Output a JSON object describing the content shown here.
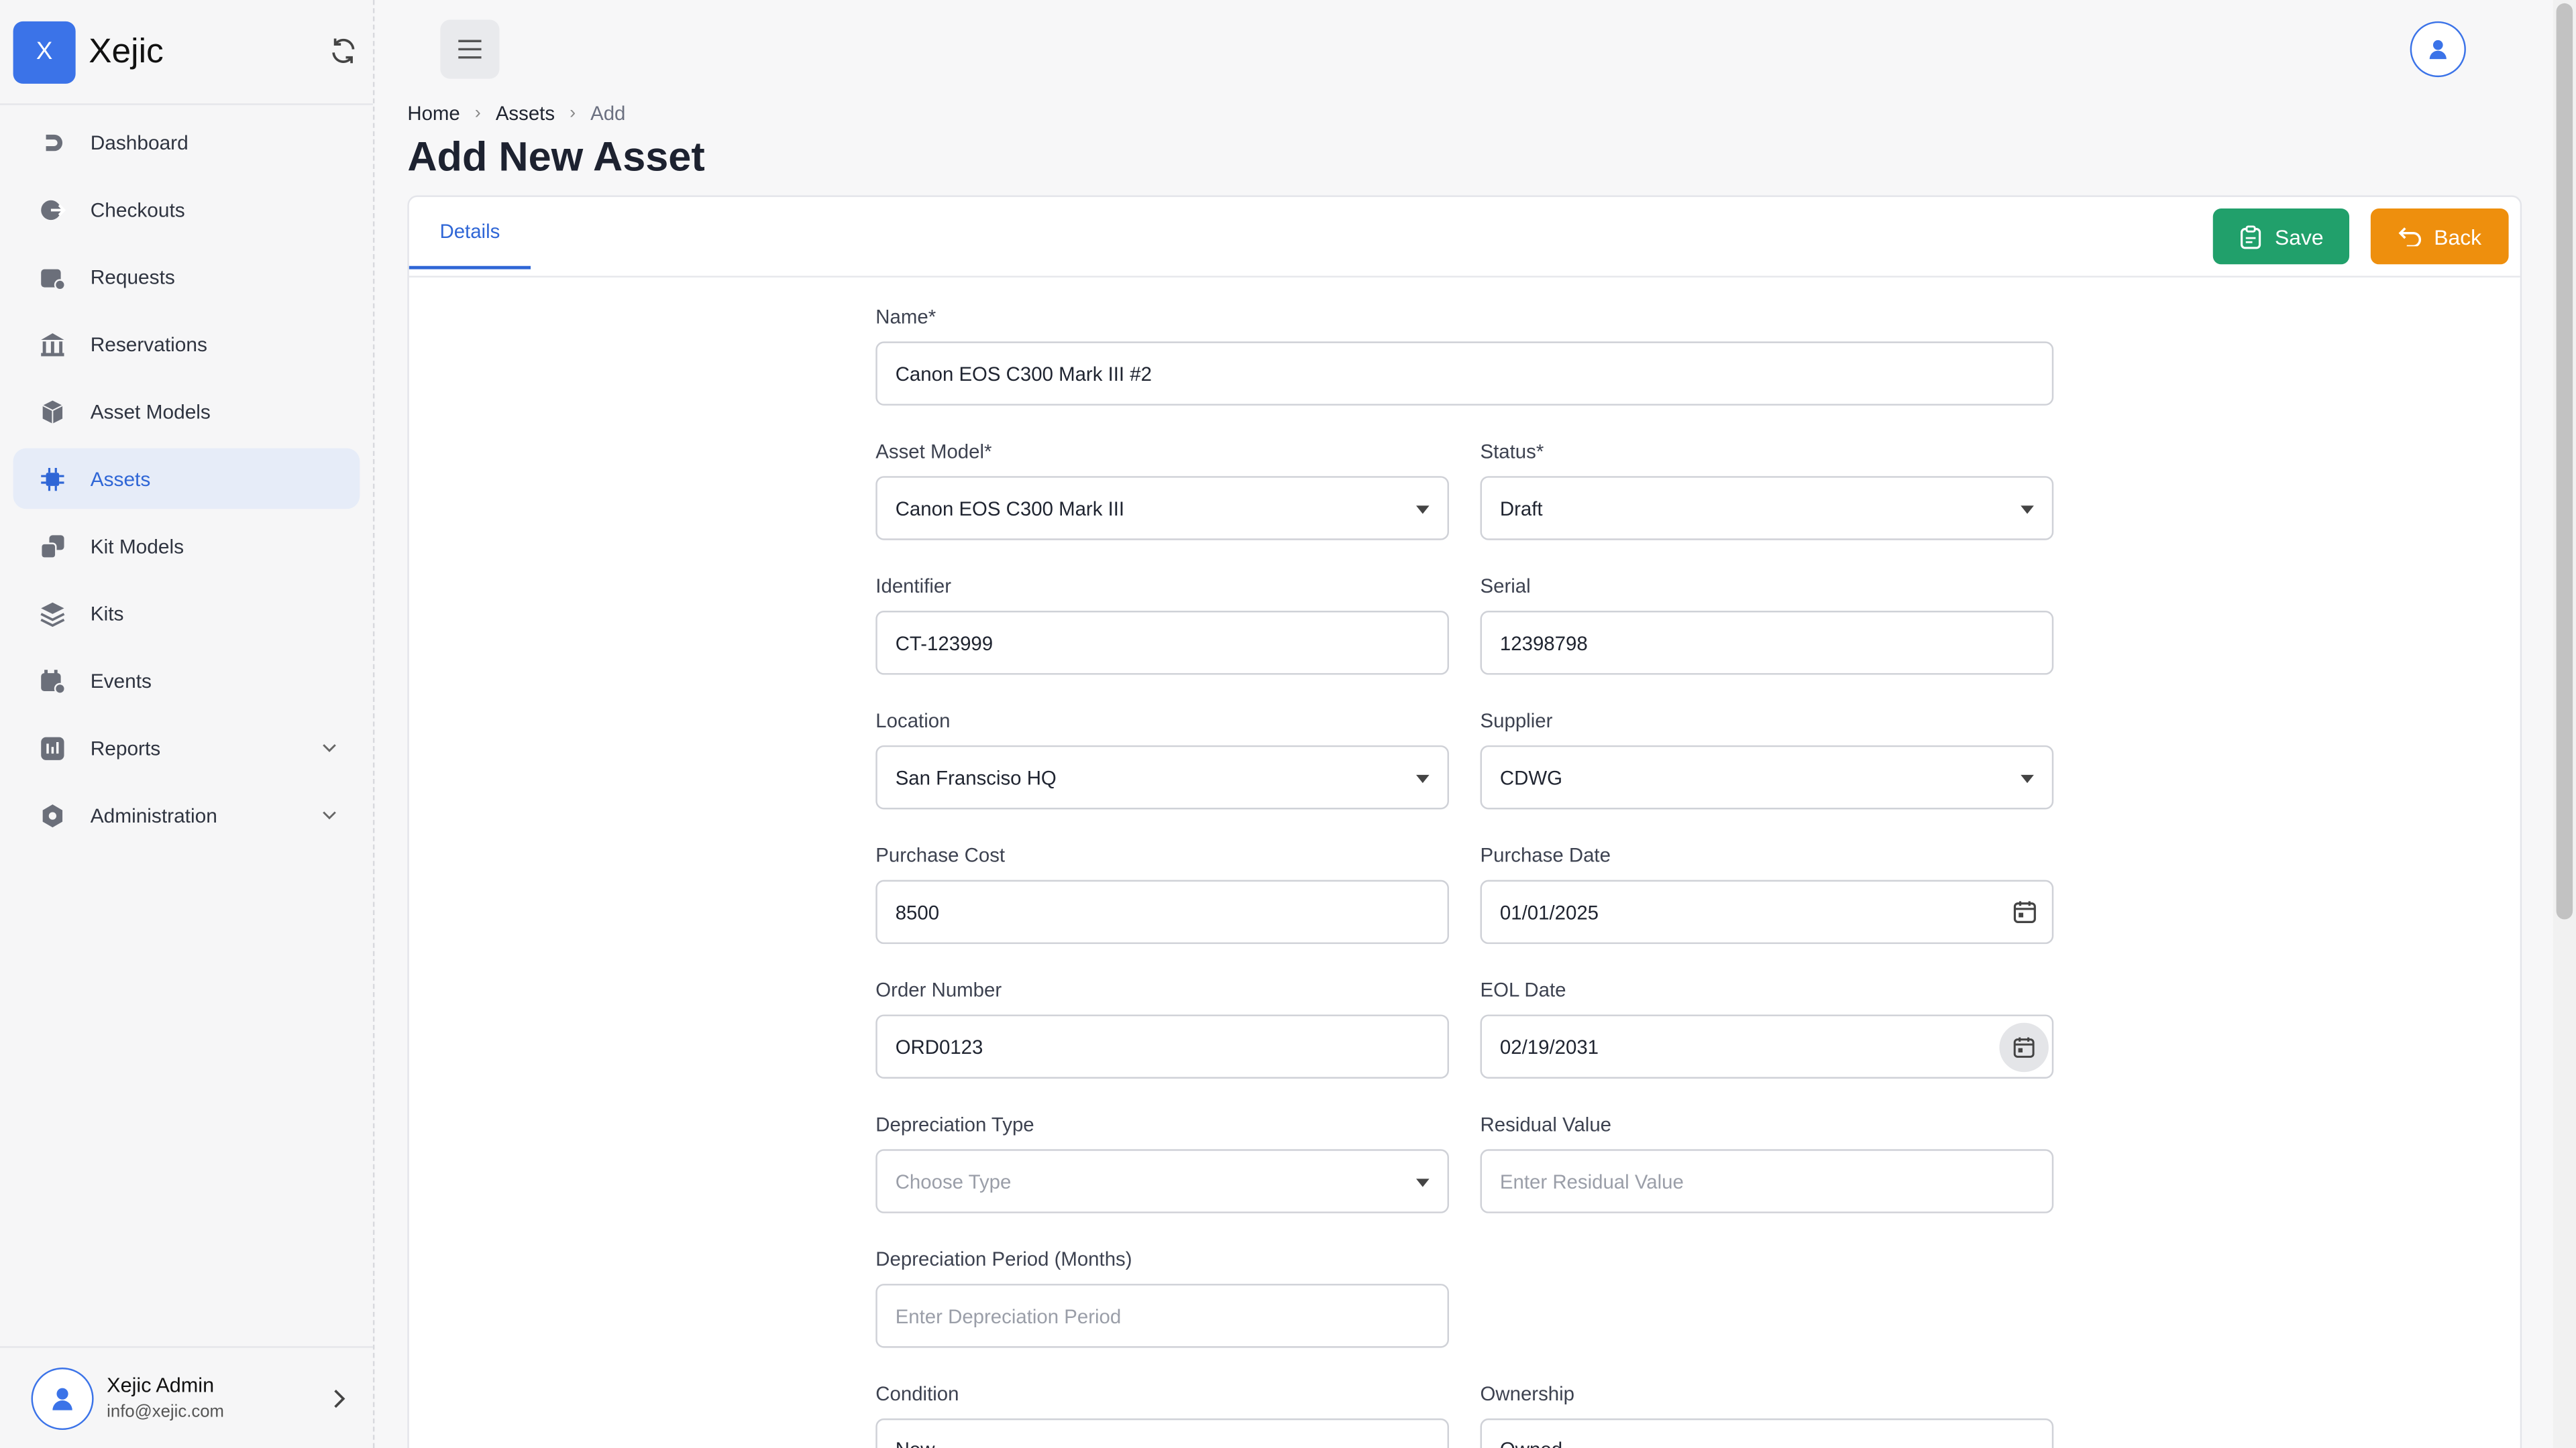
{
  "app": {
    "logo_letter": "X",
    "name": "Xejic"
  },
  "sidebar": {
    "items": [
      {
        "label": "Dashboard",
        "icon": "dashboard-icon"
      },
      {
        "label": "Checkouts",
        "icon": "checkout-icon"
      },
      {
        "label": "Requests",
        "icon": "requests-icon"
      },
      {
        "label": "Reservations",
        "icon": "reservations-icon"
      },
      {
        "label": "Asset Models",
        "icon": "asset-models-icon"
      },
      {
        "label": "Assets",
        "icon": "assets-icon",
        "active": true
      },
      {
        "label": "Kit Models",
        "icon": "kit-models-icon"
      },
      {
        "label": "Kits",
        "icon": "kits-icon"
      },
      {
        "label": "Events",
        "icon": "events-icon"
      },
      {
        "label": "Reports",
        "icon": "reports-icon",
        "expandable": true
      },
      {
        "label": "Administration",
        "icon": "administration-icon",
        "expandable": true
      }
    ],
    "user": {
      "name": "Xejic Admin",
      "email": "info@xejic.com"
    }
  },
  "breadcrumb": {
    "home": "Home",
    "section": "Assets",
    "current": "Add"
  },
  "page": {
    "title": "Add New Asset"
  },
  "tabs": {
    "details": "Details"
  },
  "actions": {
    "save": "Save",
    "back": "Back"
  },
  "form": {
    "name": {
      "label": "Name",
      "required": "*",
      "value": "Canon EOS C300 Mark III  #2"
    },
    "asset_model": {
      "label": "Asset Model",
      "required": "*",
      "value": "Canon EOS C300 Mark III"
    },
    "status": {
      "label": "Status",
      "required": "*",
      "value": "Draft"
    },
    "identifier": {
      "label": "Identifier",
      "value": "CT-123999"
    },
    "serial": {
      "label": "Serial",
      "value": "12398798"
    },
    "location": {
      "label": "Location",
      "value": "San Fransciso HQ"
    },
    "supplier": {
      "label": "Supplier",
      "value": "CDWG"
    },
    "purchase_cost": {
      "label": "Purchase Cost",
      "value": "8500"
    },
    "purchase_date": {
      "label": "Purchase Date",
      "value": "01/01/2025"
    },
    "order_number": {
      "label": "Order Number",
      "value": "ORD0123"
    },
    "eol_date": {
      "label": "EOL Date",
      "value": "02/19/2031"
    },
    "depreciation_type": {
      "label": "Depreciation Type",
      "placeholder": "Choose Type"
    },
    "residual_value": {
      "label": "Residual Value",
      "placeholder": "Enter Residual Value"
    },
    "depreciation_period": {
      "label": "Depreciation Period (Months)",
      "placeholder": "Enter Depreciation Period"
    },
    "condition": {
      "label": "Condition",
      "value": "New"
    },
    "ownership": {
      "label": "Ownership",
      "value": "Owned"
    }
  },
  "colors": {
    "accent": "#3b73e8",
    "save": "#21a06b",
    "back": "#ee8f0d"
  }
}
